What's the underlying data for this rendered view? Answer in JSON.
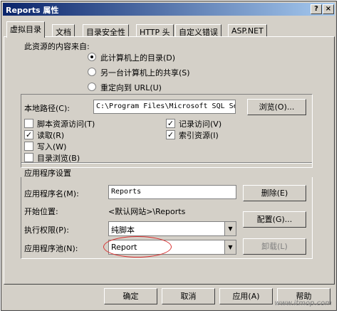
{
  "window": {
    "title": "Reports 属性",
    "help_icon": "?",
    "close_icon": "×"
  },
  "tabs": [
    "虚拟目录",
    "文档",
    "目录安全性",
    "HTTP 头",
    "自定义错误",
    "ASP.NET"
  ],
  "source": {
    "heading": "此资源的内容来自:",
    "options": [
      "此计算机上的目录(D)",
      "另一台计算机上的共享(S)",
      "重定向到 URL(U)"
    ],
    "selected": "此计算机上的目录(D)"
  },
  "local_path": {
    "label": "本地路径(C):",
    "value": "C:\\Program Files\\Microsoft SQL Se",
    "browse_label": "浏览(O)..."
  },
  "checkboxes": {
    "script_access": {
      "label": "脚本资源访问(T)",
      "checked": false
    },
    "read": {
      "label": "读取(R)",
      "checked": true
    },
    "write": {
      "label": "写入(W)",
      "checked": false
    },
    "dir_browse": {
      "label": "目录浏览(B)",
      "checked": false
    },
    "log_visits": {
      "label": "记录访问(V)",
      "checked": true
    },
    "index": {
      "label": "索引资源(I)",
      "checked": true
    }
  },
  "app": {
    "heading": "应用程序设置",
    "name_label": "应用程序名(M):",
    "name_value": "Reports",
    "remove_label": "删除(E)",
    "start_label": "开始位置:",
    "start_value": "<默认网站>\\Reports",
    "config_label": "配置(G)...",
    "exec_label": "执行权限(P):",
    "exec_value": "纯脚本",
    "pool_label": "应用程序池(N):",
    "pool_value": "Report",
    "unload_label": "卸载(L)"
  },
  "footer": {
    "ok": "确定",
    "cancel": "取消",
    "apply": "应用(A)",
    "help": "帮助"
  },
  "watermark": "www.itmop.com",
  "highlight_color": "#d83030"
}
